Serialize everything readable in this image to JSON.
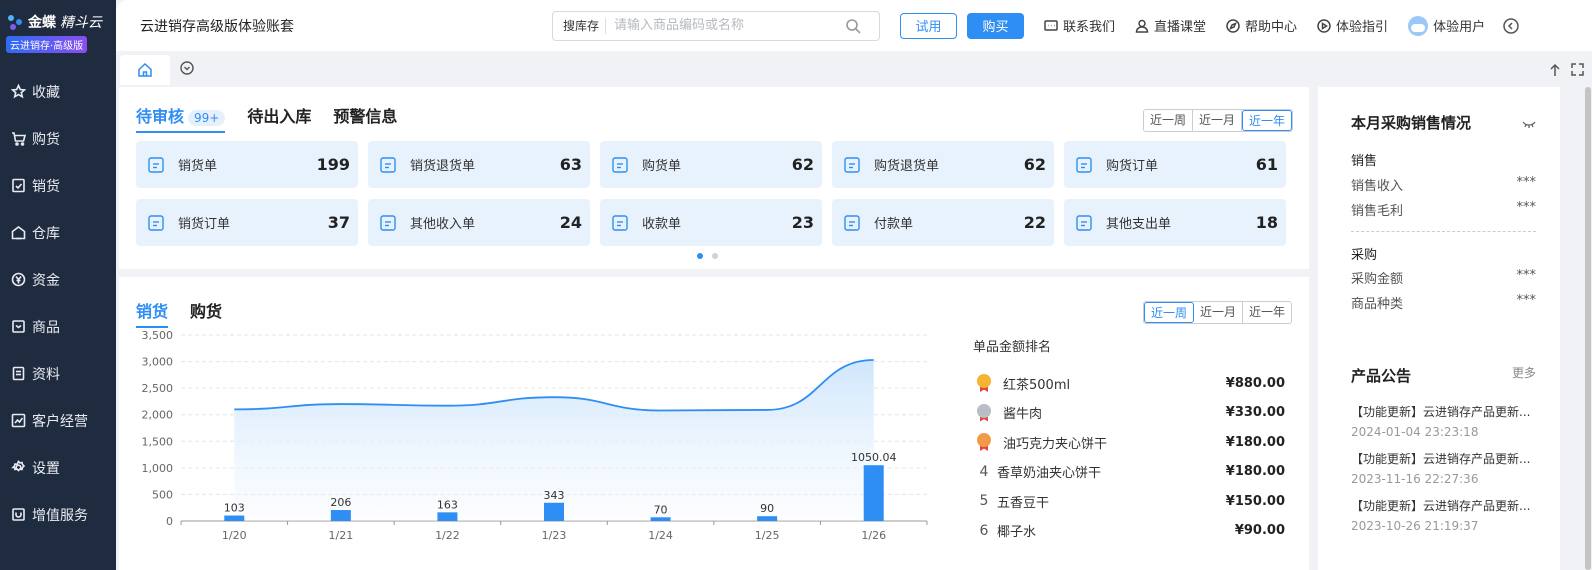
{
  "brand": {
    "name_a": "金蝶",
    "name_b": "精斗云",
    "edition": "云进销存·高级版"
  },
  "sidebar": {
    "items": [
      {
        "label": "收藏",
        "icon": "star-icon"
      },
      {
        "label": "购货",
        "icon": "cart-icon"
      },
      {
        "label": "销货",
        "icon": "sales-doc-icon"
      },
      {
        "label": "仓库",
        "icon": "warehouse-icon"
      },
      {
        "label": "资金",
        "icon": "yen-circle-icon"
      },
      {
        "label": "商品",
        "icon": "product-icon"
      },
      {
        "label": "资料",
        "icon": "document-icon"
      },
      {
        "label": "客户经营",
        "icon": "trend-icon"
      },
      {
        "label": "设置",
        "icon": "gear-icon"
      },
      {
        "label": "增值服务",
        "icon": "service-icon"
      }
    ]
  },
  "header": {
    "account_title": "云进销存高级版体验账套",
    "search_type": "搜库存",
    "search_placeholder": "请输入商品编码或名称",
    "trial_label": "试用",
    "buy_label": "购买",
    "links": [
      {
        "label": "联系我们",
        "icon": "chat-icon"
      },
      {
        "label": "直播课堂",
        "icon": "user-icon"
      },
      {
        "label": "帮助中心",
        "icon": "compass-icon"
      },
      {
        "label": "体验指引",
        "icon": "play-circle-icon"
      }
    ],
    "user_label": "体验用户"
  },
  "pending": {
    "tabs": [
      "待审核",
      "待出入库",
      "预警信息"
    ],
    "badge": "99+",
    "ranges": [
      "近一周",
      "近一月",
      "近一年"
    ],
    "active_range": 2,
    "cards": [
      {
        "label": "销货单",
        "value": "199",
        "icon": "cart-icon"
      },
      {
        "label": "销货退货单",
        "value": "63",
        "icon": "return-icon"
      },
      {
        "label": "购货单",
        "value": "62",
        "icon": "cart-plus-icon"
      },
      {
        "label": "购货退货单",
        "value": "62",
        "icon": "basket-return-icon"
      },
      {
        "label": "购货订单",
        "value": "61",
        "icon": "clipboard-icon"
      },
      {
        "label": "销货订单",
        "value": "37",
        "icon": "order-doc-icon"
      },
      {
        "label": "其他收入单",
        "value": "24",
        "icon": "yen-in-icon"
      },
      {
        "label": "收款单",
        "value": "23",
        "icon": "wallet-icon"
      },
      {
        "label": "付款单",
        "value": "22",
        "icon": "yen-doc-icon"
      },
      {
        "label": "其他支出单",
        "value": "18",
        "icon": "yen-out-icon"
      }
    ]
  },
  "sales": {
    "tabs": [
      "销货",
      "购货"
    ],
    "ranges": [
      "近一周",
      "近一月",
      "近一年"
    ],
    "active_range": 0,
    "ranking_title": "单品金额排名",
    "ranking": [
      {
        "rank": "1",
        "name": "红茶500ml",
        "amount": "¥880.00",
        "medal": "gold"
      },
      {
        "rank": "2",
        "name": "酱牛肉",
        "amount": "¥330.00",
        "medal": "silver"
      },
      {
        "rank": "3",
        "name": "油巧克力夹心饼干",
        "amount": "¥180.00",
        "medal": "bronze"
      },
      {
        "rank": "4",
        "name": "香草奶油夹心饼干",
        "amount": "¥180.00",
        "medal": ""
      },
      {
        "rank": "5",
        "name": "五香豆干",
        "amount": "¥150.00",
        "medal": ""
      },
      {
        "rank": "6",
        "name": "椰子水",
        "amount": "¥90.00",
        "medal": ""
      }
    ]
  },
  "chart_data": {
    "type": "bar",
    "categories": [
      "1/20",
      "1/21",
      "1/22",
      "1/23",
      "1/24",
      "1/25",
      "1/26"
    ],
    "series": [
      {
        "type": "bar",
        "values": [
          103,
          206,
          163,
          343,
          70,
          90,
          1050.04
        ],
        "color": "#2f8ef4"
      },
      {
        "type": "area",
        "values": [
          2100,
          2200,
          2170,
          2330,
          2080,
          2090,
          3030
        ],
        "color": "#2f8ef4"
      }
    ],
    "data_labels": [
      "103",
      "206",
      "163",
      "343",
      "70",
      "90",
      "1050.04"
    ],
    "yticks": [
      "0",
      "500",
      "1,000",
      "1,500",
      "2,000",
      "2,500",
      "3,000",
      "3,500"
    ],
    "ylim": [
      0,
      3500
    ],
    "grid": true
  },
  "summary": {
    "title": "本月采购销售情况",
    "sales_section": "销售",
    "sales_rows": [
      {
        "label": "销售收入",
        "value": "***"
      },
      {
        "label": "销售毛利",
        "value": "***"
      }
    ],
    "purchase_section": "采购",
    "purchase_rows": [
      {
        "label": "采购金额",
        "value": "***"
      },
      {
        "label": "商品种类",
        "value": "***"
      }
    ]
  },
  "notices": {
    "title": "产品公告",
    "more": "更多",
    "items": [
      {
        "title": "【功能更新】云进销存产品更新...",
        "date": "2024-01-04 23:23:18"
      },
      {
        "title": "【功能更新】云进销存产品更新...",
        "date": "2023-11-16 22:27:36"
      },
      {
        "title": "【功能更新】云进销存产品更新...",
        "date": "2023-10-26 21:19:37"
      }
    ]
  }
}
